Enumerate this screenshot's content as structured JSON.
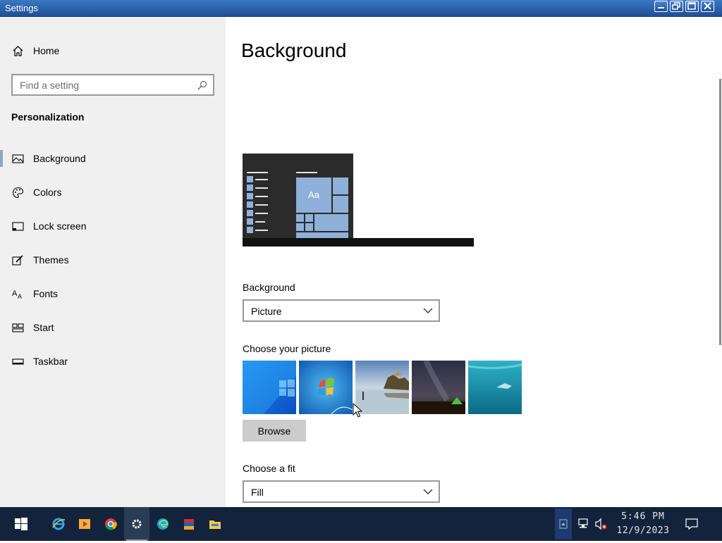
{
  "window": {
    "title": "Settings"
  },
  "sidebar": {
    "home_label": "Home",
    "search_placeholder": "Find a setting",
    "section_title": "Personalization",
    "items": [
      {
        "label": "Background",
        "icon": "picture-icon",
        "selected": true
      },
      {
        "label": "Colors",
        "icon": "palette-icon"
      },
      {
        "label": "Lock screen",
        "icon": "lock-screen-icon"
      },
      {
        "label": "Themes",
        "icon": "brush-icon"
      },
      {
        "label": "Fonts",
        "icon": "fonts-icon"
      },
      {
        "label": "Start",
        "icon": "start-icon"
      },
      {
        "label": "Taskbar",
        "icon": "taskbar-icon"
      }
    ]
  },
  "main": {
    "title": "Background",
    "preview_sample_text": "Aa",
    "background_label": "Background",
    "background_value": "Picture",
    "choose_picture_label": "Choose your picture",
    "pictures": [
      "windows-10-blue",
      "windows-7-logo",
      "beach-rocks",
      "night-sky-tent",
      "underwater-swimmer"
    ],
    "browse_label": "Browse",
    "fit_label": "Choose a fit",
    "fit_value": "Fill"
  },
  "taskbar": {
    "apps": [
      "internet-explorer-icon",
      "media-player-icon",
      "chrome-icon",
      "settings-icon",
      "edge-icon",
      "winrar-icon",
      "file-explorer-icon"
    ],
    "active_app": "settings-icon",
    "time": "5:46 PM",
    "date": "12/9/2023"
  },
  "colors": {
    "titlebar": "#2a5fa8",
    "sidebar_bg": "#f0f0f0",
    "accent_preview": "#8fb0d8",
    "taskbar_bg": "#13233b"
  }
}
